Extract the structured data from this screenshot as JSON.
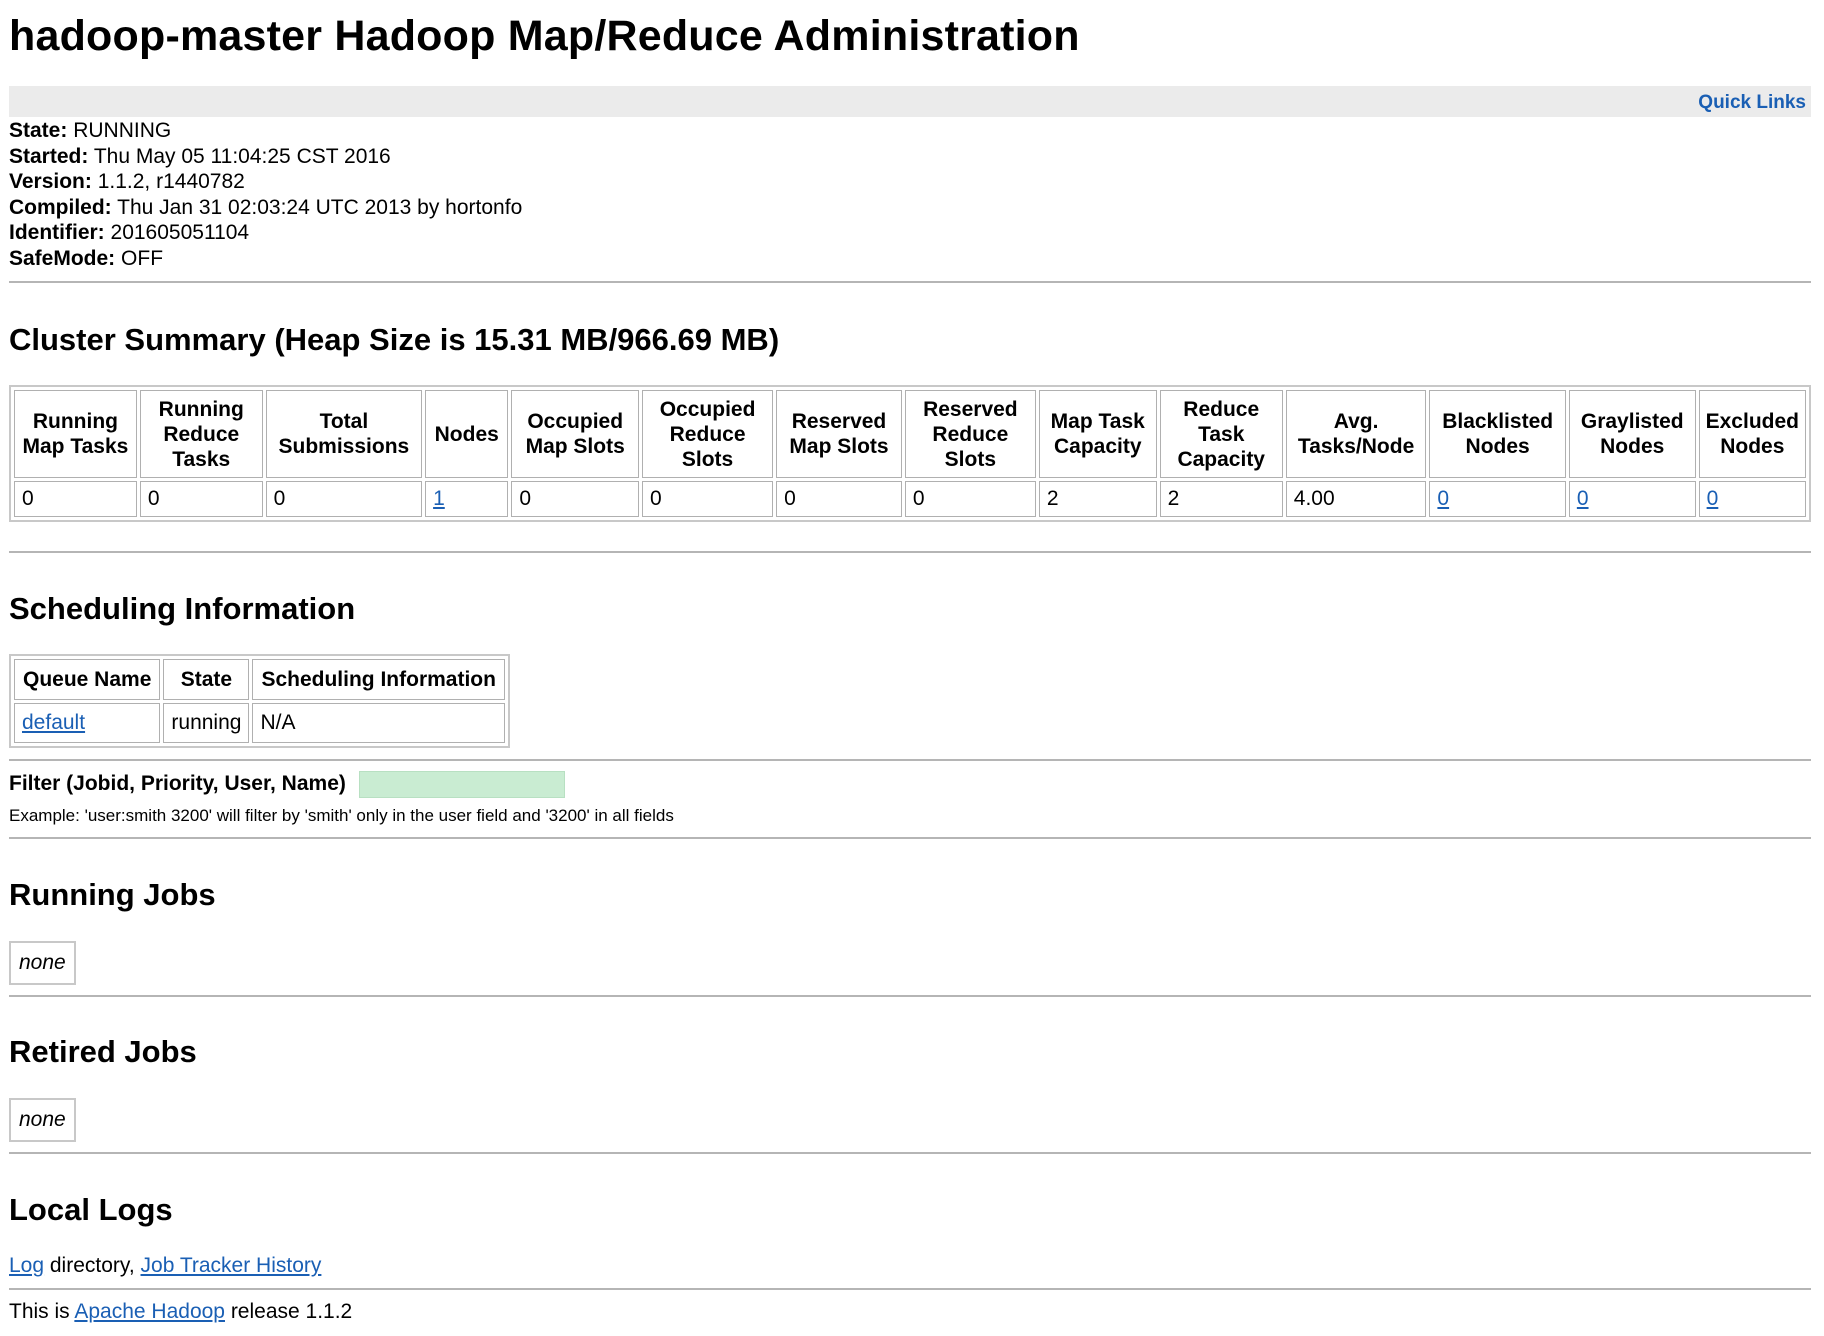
{
  "title": "hadoop-master Hadoop Map/Reduce Administration",
  "quick_links": "Quick Links",
  "info": {
    "state_label": "State:",
    "state": "RUNNING",
    "started_label": "Started:",
    "started": "Thu May 05 11:04:25 CST 2016",
    "version_label": "Version:",
    "version": "1.1.2, r1440782",
    "compiled_label": "Compiled:",
    "compiled": "Thu Jan 31 02:03:24 UTC 2013 by hortonfo",
    "identifier_label": "Identifier:",
    "identifier": "201605051104",
    "safemode_label": "SafeMode:",
    "safemode": "OFF"
  },
  "cluster_summary": {
    "heading": "Cluster Summary (Heap Size is 15.31 MB/966.69 MB)",
    "headers": [
      "Running Map Tasks",
      "Running Reduce Tasks",
      "Total Submissions",
      "Nodes",
      "Occupied Map Slots",
      "Occupied Reduce Slots",
      "Reserved Map Slots",
      "Reserved Reduce Slots",
      "Map Task Capacity",
      "Reduce Task Capacity",
      "Avg. Tasks/Node",
      "Blacklisted Nodes",
      "Graylisted Nodes",
      "Excluded Nodes"
    ],
    "values": [
      "0",
      "0",
      "0",
      "1",
      "0",
      "0",
      "0",
      "0",
      "2",
      "2",
      "4.00",
      "0",
      "0",
      "0"
    ]
  },
  "scheduling": {
    "heading": "Scheduling Information",
    "headers": [
      "Queue Name",
      "State",
      "Scheduling Information"
    ],
    "row": [
      "default",
      "running",
      "N/A"
    ]
  },
  "filter": {
    "label": "Filter (Jobid, Priority, User, Name)",
    "value": "",
    "example": "Example: 'user:smith 3200' will filter by 'smith' only in the user field and '3200' in all fields"
  },
  "running_jobs": {
    "heading": "Running Jobs",
    "empty": "none"
  },
  "retired_jobs": {
    "heading": "Retired Jobs",
    "empty": "none"
  },
  "local_logs": {
    "heading": "Local Logs",
    "log_link": "Log",
    "directory_text": " directory, ",
    "history_link": "Job Tracker History"
  },
  "footer": {
    "prefix": "This is ",
    "link": "Apache Hadoop",
    "suffix": " release 1.1.2"
  }
}
